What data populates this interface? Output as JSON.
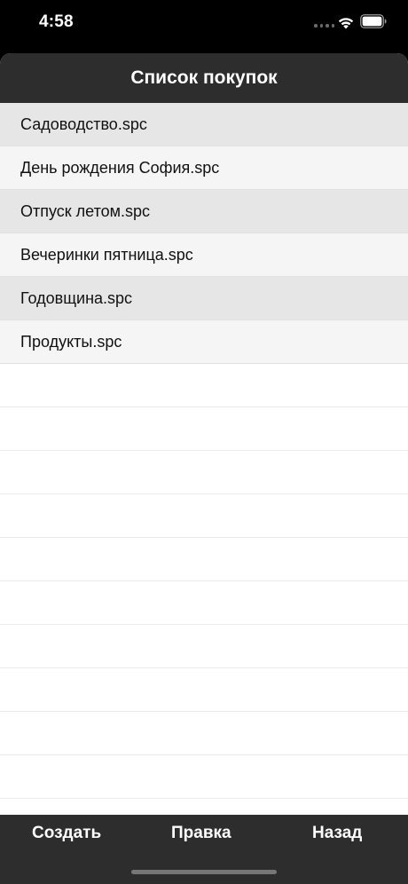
{
  "status_bar": {
    "time": "4:58",
    "icons": [
      "signal-icon",
      "wifi-icon",
      "battery-icon"
    ]
  },
  "nav": {
    "title": "Список покупок"
  },
  "files": [
    {
      "name": "Садоводство.spc"
    },
    {
      "name": "День рождения София.spc"
    },
    {
      "name": "Отпуск летом.spc"
    },
    {
      "name": "Вечеринки пятница.spc"
    },
    {
      "name": "Годовщина.spc"
    },
    {
      "name": "Продукты.spc"
    }
  ],
  "toolbar": {
    "create_label": "Создать",
    "edit_label": "Правка",
    "back_label": "Назад"
  },
  "colors": {
    "bar_background": "#2d2d2d",
    "row_odd": "#e6e6e6",
    "row_even": "#f5f5f5"
  }
}
